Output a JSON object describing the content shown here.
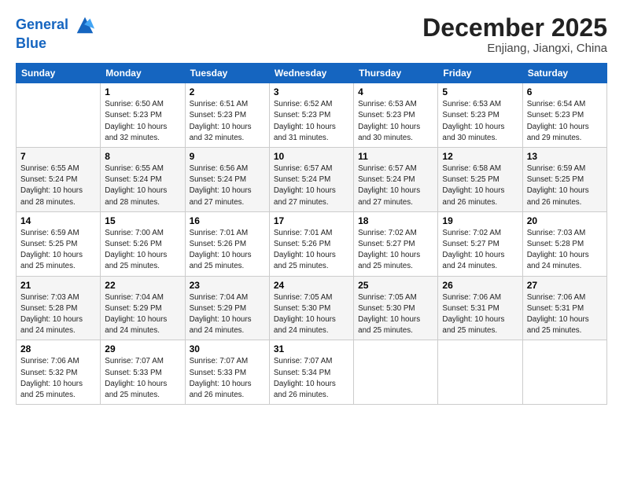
{
  "header": {
    "logo_line1": "General",
    "logo_line2": "Blue",
    "month_year": "December 2025",
    "location": "Enjiang, Jiangxi, China"
  },
  "days_of_week": [
    "Sunday",
    "Monday",
    "Tuesday",
    "Wednesday",
    "Thursday",
    "Friday",
    "Saturday"
  ],
  "weeks": [
    [
      {
        "day": "",
        "info": ""
      },
      {
        "day": "1",
        "info": "Sunrise: 6:50 AM\nSunset: 5:23 PM\nDaylight: 10 hours\nand 32 minutes."
      },
      {
        "day": "2",
        "info": "Sunrise: 6:51 AM\nSunset: 5:23 PM\nDaylight: 10 hours\nand 32 minutes."
      },
      {
        "day": "3",
        "info": "Sunrise: 6:52 AM\nSunset: 5:23 PM\nDaylight: 10 hours\nand 31 minutes."
      },
      {
        "day": "4",
        "info": "Sunrise: 6:53 AM\nSunset: 5:23 PM\nDaylight: 10 hours\nand 30 minutes."
      },
      {
        "day": "5",
        "info": "Sunrise: 6:53 AM\nSunset: 5:23 PM\nDaylight: 10 hours\nand 30 minutes."
      },
      {
        "day": "6",
        "info": "Sunrise: 6:54 AM\nSunset: 5:23 PM\nDaylight: 10 hours\nand 29 minutes."
      }
    ],
    [
      {
        "day": "7",
        "info": "Sunrise: 6:55 AM\nSunset: 5:24 PM\nDaylight: 10 hours\nand 28 minutes."
      },
      {
        "day": "8",
        "info": "Sunrise: 6:55 AM\nSunset: 5:24 PM\nDaylight: 10 hours\nand 28 minutes."
      },
      {
        "day": "9",
        "info": "Sunrise: 6:56 AM\nSunset: 5:24 PM\nDaylight: 10 hours\nand 27 minutes."
      },
      {
        "day": "10",
        "info": "Sunrise: 6:57 AM\nSunset: 5:24 PM\nDaylight: 10 hours\nand 27 minutes."
      },
      {
        "day": "11",
        "info": "Sunrise: 6:57 AM\nSunset: 5:24 PM\nDaylight: 10 hours\nand 27 minutes."
      },
      {
        "day": "12",
        "info": "Sunrise: 6:58 AM\nSunset: 5:25 PM\nDaylight: 10 hours\nand 26 minutes."
      },
      {
        "day": "13",
        "info": "Sunrise: 6:59 AM\nSunset: 5:25 PM\nDaylight: 10 hours\nand 26 minutes."
      }
    ],
    [
      {
        "day": "14",
        "info": "Sunrise: 6:59 AM\nSunset: 5:25 PM\nDaylight: 10 hours\nand 25 minutes."
      },
      {
        "day": "15",
        "info": "Sunrise: 7:00 AM\nSunset: 5:26 PM\nDaylight: 10 hours\nand 25 minutes."
      },
      {
        "day": "16",
        "info": "Sunrise: 7:01 AM\nSunset: 5:26 PM\nDaylight: 10 hours\nand 25 minutes."
      },
      {
        "day": "17",
        "info": "Sunrise: 7:01 AM\nSunset: 5:26 PM\nDaylight: 10 hours\nand 25 minutes."
      },
      {
        "day": "18",
        "info": "Sunrise: 7:02 AM\nSunset: 5:27 PM\nDaylight: 10 hours\nand 25 minutes."
      },
      {
        "day": "19",
        "info": "Sunrise: 7:02 AM\nSunset: 5:27 PM\nDaylight: 10 hours\nand 24 minutes."
      },
      {
        "day": "20",
        "info": "Sunrise: 7:03 AM\nSunset: 5:28 PM\nDaylight: 10 hours\nand 24 minutes."
      }
    ],
    [
      {
        "day": "21",
        "info": "Sunrise: 7:03 AM\nSunset: 5:28 PM\nDaylight: 10 hours\nand 24 minutes."
      },
      {
        "day": "22",
        "info": "Sunrise: 7:04 AM\nSunset: 5:29 PM\nDaylight: 10 hours\nand 24 minutes."
      },
      {
        "day": "23",
        "info": "Sunrise: 7:04 AM\nSunset: 5:29 PM\nDaylight: 10 hours\nand 24 minutes."
      },
      {
        "day": "24",
        "info": "Sunrise: 7:05 AM\nSunset: 5:30 PM\nDaylight: 10 hours\nand 24 minutes."
      },
      {
        "day": "25",
        "info": "Sunrise: 7:05 AM\nSunset: 5:30 PM\nDaylight: 10 hours\nand 25 minutes."
      },
      {
        "day": "26",
        "info": "Sunrise: 7:06 AM\nSunset: 5:31 PM\nDaylight: 10 hours\nand 25 minutes."
      },
      {
        "day": "27",
        "info": "Sunrise: 7:06 AM\nSunset: 5:31 PM\nDaylight: 10 hours\nand 25 minutes."
      }
    ],
    [
      {
        "day": "28",
        "info": "Sunrise: 7:06 AM\nSunset: 5:32 PM\nDaylight: 10 hours\nand 25 minutes."
      },
      {
        "day": "29",
        "info": "Sunrise: 7:07 AM\nSunset: 5:33 PM\nDaylight: 10 hours\nand 25 minutes."
      },
      {
        "day": "30",
        "info": "Sunrise: 7:07 AM\nSunset: 5:33 PM\nDaylight: 10 hours\nand 26 minutes."
      },
      {
        "day": "31",
        "info": "Sunrise: 7:07 AM\nSunset: 5:34 PM\nDaylight: 10 hours\nand 26 minutes."
      },
      {
        "day": "",
        "info": ""
      },
      {
        "day": "",
        "info": ""
      },
      {
        "day": "",
        "info": ""
      }
    ]
  ]
}
